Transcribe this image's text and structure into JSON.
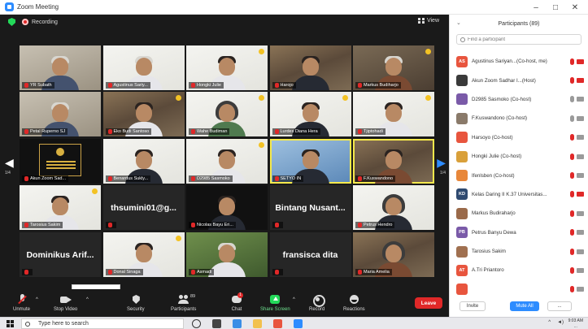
{
  "window": {
    "title": "Zoom Meeting",
    "minimize": "–",
    "maximize": "□",
    "close": "✕"
  },
  "meeting": {
    "recording_label": "Recording",
    "view_label": "View",
    "page_left": "1/4",
    "page_right": "1/4",
    "popup_text": ""
  },
  "tiles": [
    {
      "name": "YR Subath",
      "style": "wall",
      "person": "white-hair"
    },
    {
      "name": "Agustinus Sariy...",
      "style": "light",
      "person": "white-hair shirt-light"
    },
    {
      "name": "Hongki Julie",
      "style": "light",
      "person": "shirt-light",
      "badge": true
    },
    {
      "name": "Harojo",
      "style": "shelf",
      "person": "shirt-dark"
    },
    {
      "name": "Markus Budiharjo",
      "style": "room",
      "person": "white-hair shirt-batik",
      "badge": true
    },
    {
      "name": "Petal Ruperno SJ",
      "style": "wall",
      "person": "white-hair"
    },
    {
      "name": "Eko Budi Santoso",
      "style": "shelf",
      "person": "shirt-light",
      "badge": true
    },
    {
      "name": "Wahe Budiman",
      "style": "light",
      "person": "hijab shirt-green",
      "badge": true
    },
    {
      "name": "Lurdes Diana Hera",
      "style": "light",
      "person": "shirt-dark",
      "badge": true
    },
    {
      "name": "Tjiptohadi",
      "style": "light",
      "person": "shirt-light",
      "badge": true
    },
    {
      "name": "Akun Zoom Sad...",
      "style": "black",
      "poster": true
    },
    {
      "name": "Benardus Sukly...",
      "style": "light",
      "person": "shirt-dark"
    },
    {
      "name": "D2985 Sasmoko",
      "style": "light",
      "person": "shirt-light",
      "badge": true
    },
    {
      "name": "SETYO IN",
      "style": "blue",
      "person": "shirt-dark",
      "speaking": true
    },
    {
      "name": "F.Kuswandono",
      "style": "shelf",
      "person": "shirt-batik",
      "speaking": true
    },
    {
      "name": "Tarosius Sakim",
      "style": "light",
      "person": "shirt-light",
      "badge": true
    },
    {
      "name": "",
      "style": "dark",
      "big": "thsumini01@g..."
    },
    {
      "name": "Nicolas Bayu Eri...",
      "style": "black",
      "person": "shirt-dark"
    },
    {
      "name": "",
      "style": "dark",
      "big": "Bintang Nusant..."
    },
    {
      "name": "Petrus Hendro",
      "style": "light",
      "person": "hijab shirt-dark"
    },
    {
      "name": "",
      "style": "dark",
      "big": "Dominikus Arif..."
    },
    {
      "name": "Donal Sinaga",
      "style": "light",
      "person": "shirt-light",
      "badge": true
    },
    {
      "name": "Asmadi",
      "style": "garden",
      "person": "white-hair shirt-light"
    },
    {
      "name": "",
      "style": "dark",
      "big": "fransisca dita"
    },
    {
      "name": "Maria Amelia",
      "style": "shelf",
      "person": "hijab shirt-batik"
    }
  ],
  "toolbar": {
    "unmute": "Unmute",
    "stop_video": "Stop Video",
    "security": "Security",
    "participants": "Participants",
    "participants_count": "89",
    "chat": "Chat",
    "chat_badge": "1",
    "share_screen": "Share Screen",
    "record": "Record",
    "reactions": "Reactions",
    "leave": "Leave"
  },
  "participants_panel": {
    "title": "Participants (89)",
    "search_placeholder": "Find a participant",
    "list": [
      {
        "initials": "AS",
        "color": "#e8553e",
        "name": "Agustinus Sariyan...(Co-host, me)",
        "mic": "muted",
        "cam": "off"
      },
      {
        "initials": "",
        "color": "#3a3a3a",
        "name": "Akun Zoom Sadhar I...(Host)",
        "mic": "muted",
        "cam": "off"
      },
      {
        "initials": "",
        "color": "#7a5aa8",
        "name": "D2985 Sasmoko (Co-host)",
        "mic": "on",
        "cam": "on"
      },
      {
        "initials": "",
        "color": "#8a7a6a",
        "name": "F.Kuswandono (Co-host)",
        "mic": "on",
        "cam": "on"
      },
      {
        "initials": "",
        "color": "#e8553e",
        "name": "Harsoyo (Co-host)",
        "mic": "muted",
        "cam": "on"
      },
      {
        "initials": "",
        "color": "#d9a03a",
        "name": "Hongki Julie (Co-host)",
        "mic": "muted",
        "cam": "on"
      },
      {
        "initials": "",
        "color": "#e8873a",
        "name": "Ifenlsben (Co-host)",
        "mic": "muted",
        "cam": "on"
      },
      {
        "initials": "KD",
        "color": "#2f4a70",
        "name": "Kelas Daring II K.37 Universitas...",
        "mic": "muted",
        "cam": "off"
      },
      {
        "initials": "",
        "color": "#9a6a4a",
        "name": "Markus Budiraharjo",
        "mic": "muted",
        "cam": "on"
      },
      {
        "initials": "PB",
        "color": "#7a5aa8",
        "name": "Petrus Banyu Dewa",
        "mic": "muted",
        "cam": "on"
      },
      {
        "initials": "",
        "color": "#a07050",
        "name": "Tarosius Sakim",
        "mic": "muted",
        "cam": "on"
      },
      {
        "initials": "AT",
        "color": "#e8553e",
        "name": "A.Tri Priantoro",
        "mic": "muted",
        "cam": "on"
      },
      {
        "initials": "",
        "color": "#e8553e",
        "name": "",
        "mic": "muted",
        "cam": "on"
      }
    ],
    "invite": "Invite",
    "mute_all": "Mute All",
    "more": "..."
  },
  "taskbar": {
    "search_text": "Type here to search",
    "tray_caret": "^",
    "tray_vol": "◄)",
    "time": "9:03 AM",
    "date": "..."
  }
}
